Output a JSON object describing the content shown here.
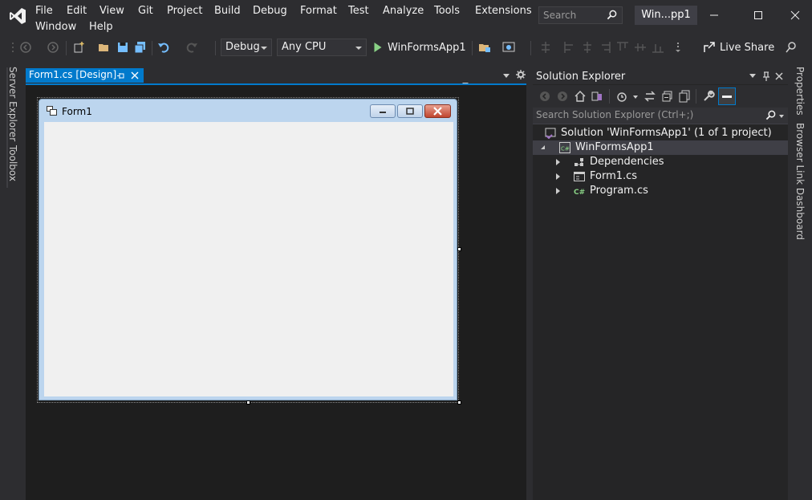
{
  "menu": {
    "items": [
      "File",
      "Edit",
      "View",
      "Git",
      "Project",
      "Build",
      "Debug",
      "Format",
      "Test",
      "Analyze",
      "Tools",
      "Extensions",
      "Window",
      "Help"
    ],
    "search_placeholder": "Search",
    "solution_badge": "Win...pp1"
  },
  "toolbar": {
    "configuration": "Debug",
    "platform": "Any CPU",
    "start_label": "WinFormsApp1",
    "live_share": "Live Share"
  },
  "left_strip": {
    "server_explorer": "Server Explorer",
    "toolbox": "Toolbox"
  },
  "right_strip": {
    "properties": "Properties",
    "browser_link": "Browser Link Dashboard"
  },
  "document": {
    "tab_label": "Form1.cs [Design]",
    "form_caption": "Form1"
  },
  "solution_explorer": {
    "title": "Solution Explorer",
    "search_placeholder": "Search Solution Explorer (Ctrl+;)",
    "solution": "Solution 'WinFormsApp1' (1 of 1 project)",
    "project": "WinFormsApp1",
    "items": [
      "Dependencies",
      "Form1.cs",
      "Program.cs"
    ]
  },
  "colors": {
    "accent": "#007acc",
    "vs_logo": "#a074c4",
    "start_green": "#89d185"
  }
}
